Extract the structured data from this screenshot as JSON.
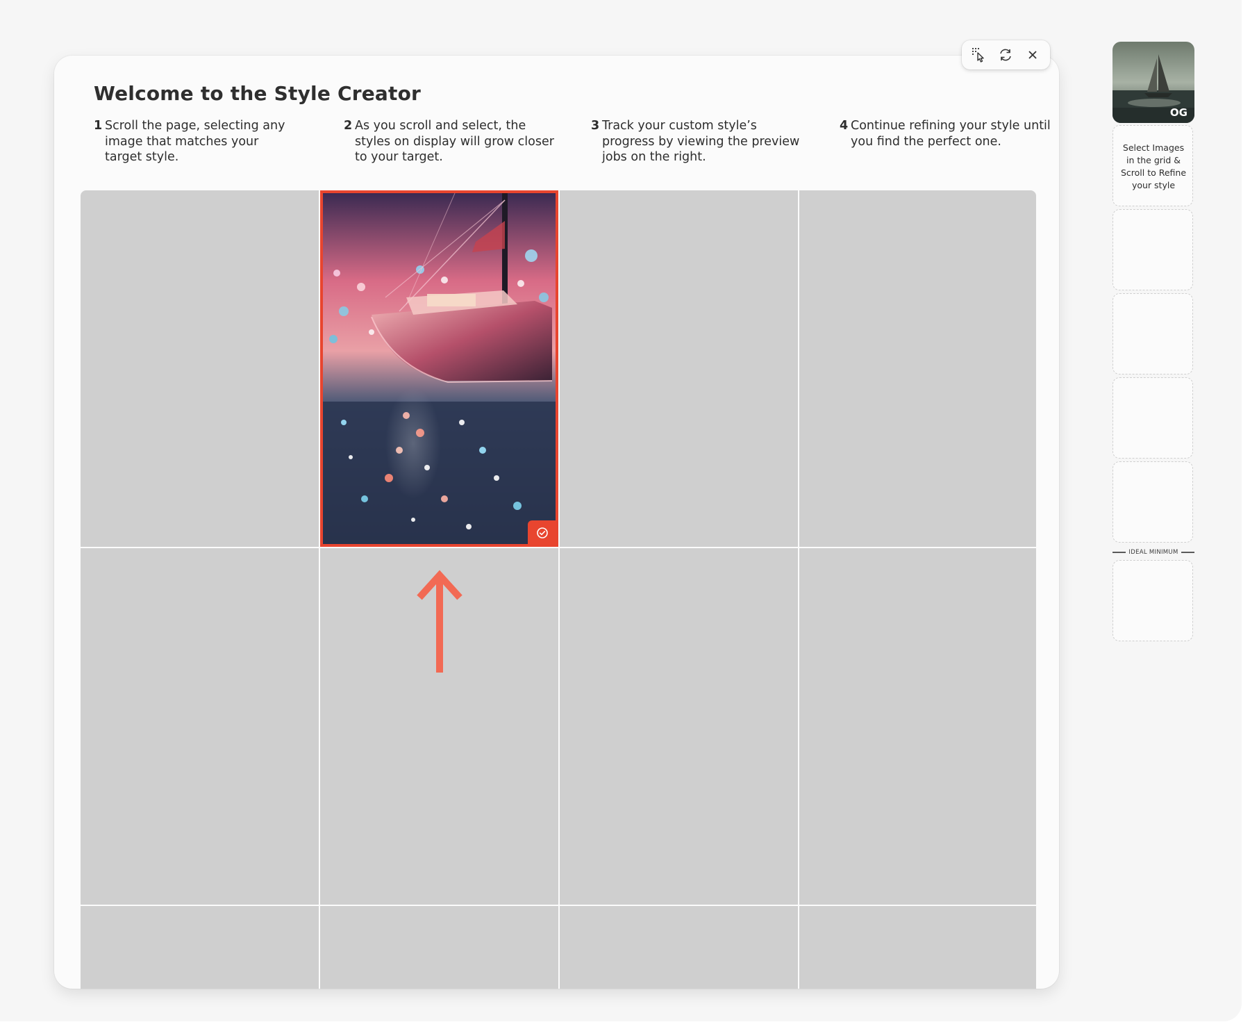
{
  "page": {
    "title": "Welcome to the Style Creator"
  },
  "steps": [
    {
      "number": "1",
      "text": "Scroll the page, selecting any image that matches your target style."
    },
    {
      "number": "2",
      "text": "As you scroll and select, the styles on display will grow closer to your target."
    },
    {
      "number": "3",
      "text": "Track your custom style’s progress by viewing the preview jobs on the right."
    },
    {
      "number": "4",
      "text": "Continue refining your style until you find the perfect one."
    }
  ],
  "toolbar": {
    "icons": [
      "multi-select-pointer-icon",
      "refresh-icon",
      "close-icon"
    ]
  },
  "grid": {
    "columns": 4,
    "visible_rows": 3,
    "selected_cell": {
      "row": 1,
      "column": 2,
      "content": "sailboat at dusk with bokeh city lights",
      "selected": true
    }
  },
  "sidebar": {
    "og_label": "OG",
    "hint": "Select Images in the grid & Scroll to Refine your style",
    "ideal_minimum_label": "IDEAL MINIMUM",
    "empty_slots_before_marker": 4,
    "empty_slots_after_marker": 1
  },
  "colors": {
    "accent": "#e8452f",
    "arrow": "#f26a54",
    "cell_placeholder": "#cfcfcf",
    "panel_bg": "#fbfbfb"
  }
}
